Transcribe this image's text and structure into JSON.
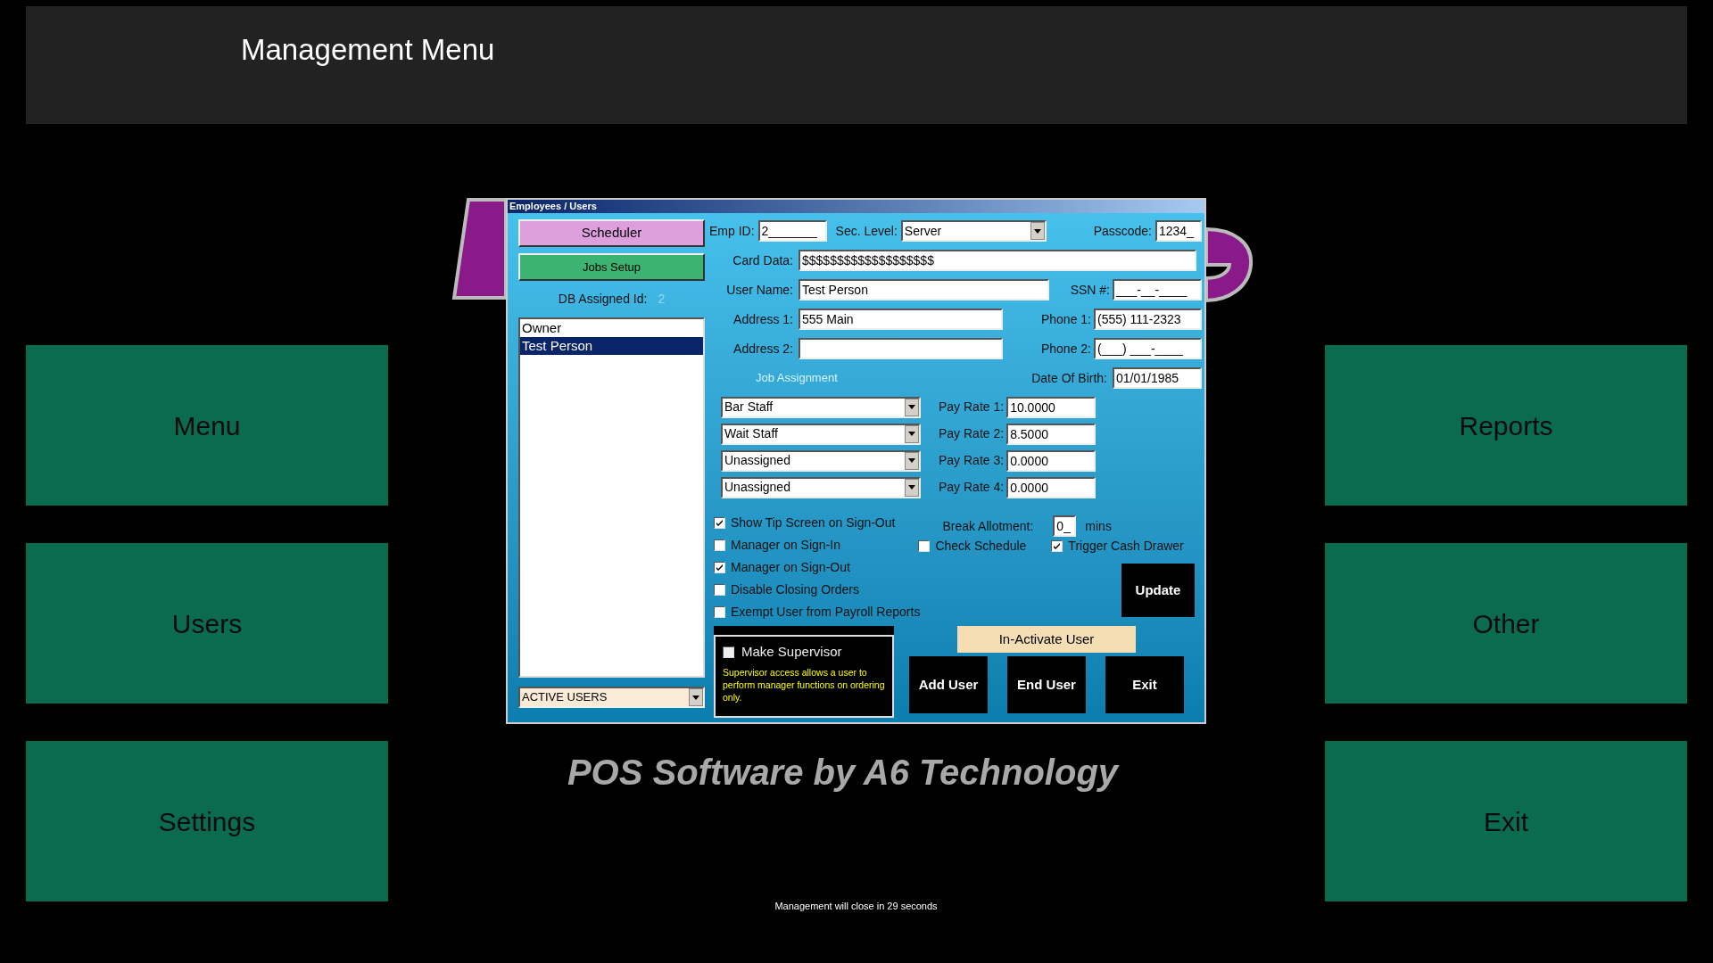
{
  "header": {
    "title": "Management Menu"
  },
  "left_tiles": [
    {
      "label": "Menu"
    },
    {
      "label": "Users"
    },
    {
      "label": "Settings"
    }
  ],
  "right_tiles": [
    {
      "label": "Reports"
    },
    {
      "label": "Other"
    },
    {
      "label": "Exit"
    }
  ],
  "background": {
    "tagline": "POS Software by A6 Technology"
  },
  "dialog": {
    "title": "Employees / Users",
    "side_buttons": [
      {
        "label": "Scheduler",
        "color": "#dda0dd"
      },
      {
        "label": "Jobs Setup",
        "color": "#3cb371"
      }
    ],
    "db_assigned_id": {
      "label": "DB Assigned Id:",
      "value": "2"
    },
    "users": [
      {
        "name": "Owner",
        "selected": false
      },
      {
        "name": "Test Person",
        "selected": true
      }
    ],
    "user_filter": {
      "value": "ACTIVE USERS"
    },
    "emp_id": {
      "label": "Emp ID:",
      "value": "2_______"
    },
    "sec_level": {
      "label": "Sec. Level:",
      "value": "Server"
    },
    "passcode": {
      "label": "Passcode:",
      "value": "1234_"
    },
    "card_data": {
      "label": "Card Data:",
      "value": "$$$$$$$$$$$$$$$$$$$"
    },
    "user_name": {
      "label": "User Name:",
      "value": "Test Person"
    },
    "ssn": {
      "label": "SSN #:",
      "value": "___-__-____"
    },
    "address_1": {
      "label": "Address 1:",
      "value": "555 Main"
    },
    "phone_1": {
      "label": "Phone 1:",
      "value": "(555) 111-2323"
    },
    "address_2": {
      "label": "Address 2:"
    },
    "phone_2": {
      "label": "Phone 2:",
      "value": "(___) ___-____"
    },
    "job_assignment": {
      "title": "Job Assignment"
    },
    "date_of_birth": {
      "label": "Date Of Birth:",
      "value": "01/01/1985"
    },
    "jobs": [
      {
        "job": "Bar Staff",
        "pay_label": "Pay Rate 1:",
        "pay_rate": "10.0000"
      },
      {
        "job": "Wait Staff",
        "pay_label": "Pay Rate 2:",
        "pay_rate": "8.5000"
      },
      {
        "job": "Unassigned",
        "pay_label": "Pay Rate 3:",
        "pay_rate": "0.0000"
      },
      {
        "job": "Unassigned",
        "pay_label": "Pay Rate 4:",
        "pay_rate": "0.0000"
      }
    ],
    "options": [
      {
        "label": "Show Tip Screen on Sign-Out",
        "checked": true
      },
      {
        "label": "Manager on Sign-In",
        "checked": false
      },
      {
        "label": "Manager on Sign-Out",
        "checked": true
      },
      {
        "label": "Disable Closing Orders",
        "checked": false
      },
      {
        "label": "Exempt User from Payroll Reports",
        "checked": false
      }
    ],
    "break_allotment": {
      "label": "Break Allotment:",
      "value": "0_",
      "unit": "mins"
    },
    "check_schedule": {
      "label": "Check Schedule",
      "checked": false
    },
    "trigger_cash_drawer": {
      "label": "Trigger Cash Drawer",
      "checked": true
    },
    "update_button": {
      "label": "Update"
    },
    "supervisor": {
      "label": "Make Supervisor",
      "checked": false,
      "note": "Supervisor access allows a user to perform manager functions on ordering only."
    },
    "inactivate_button": {
      "label": "In-Activate User"
    },
    "action_buttons": [
      {
        "label": "Add User"
      },
      {
        "label": "End User"
      },
      {
        "label": "Exit"
      }
    ]
  },
  "footer": {
    "text": "Management will close in 29 seconds"
  }
}
